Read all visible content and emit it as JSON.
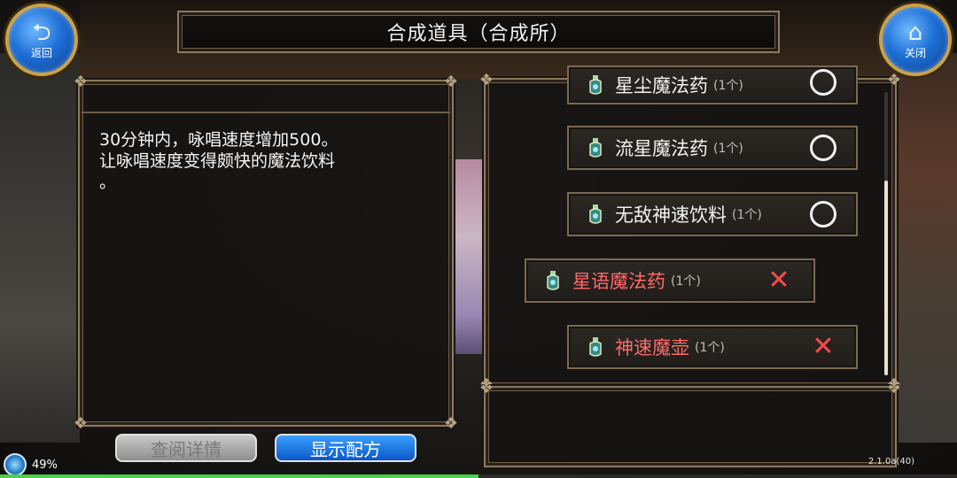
{
  "header": {
    "title": "合成道具（合成所）",
    "back_label": "返回",
    "close_label": "关闭"
  },
  "description": {
    "text": "30分钟内，咏唱速度增加500。\n让咏唱速度变得颇快的魔法饮料\n。"
  },
  "recipe_list": {
    "items": [
      {
        "name": "星尘魔法药",
        "count": "(1个)",
        "status": "circle",
        "name_color": "white"
      },
      {
        "name": "流星魔法药",
        "count": "(1个)",
        "status": "circle",
        "name_color": "white"
      },
      {
        "name": "无敌神速饮料",
        "count": "(1个)",
        "status": "circle",
        "name_color": "white"
      },
      {
        "name": "星语魔法药",
        "count": "(1个)",
        "status": "cross",
        "name_color": "red"
      },
      {
        "name": "神速魔壶",
        "count": "(1个)",
        "status": "cross",
        "name_color": "red"
      }
    ]
  },
  "buttons": {
    "view_details": "查阅详情",
    "show_recipe": "显示配方"
  },
  "status_bar": {
    "battery": "49%",
    "version": "2.1.0a(40)",
    "progress": 0.5
  },
  "colors": {
    "accent_blue": "#1e6fd6",
    "frame_gold": "#8c7a60",
    "missing_red": "#ff4a4a"
  }
}
